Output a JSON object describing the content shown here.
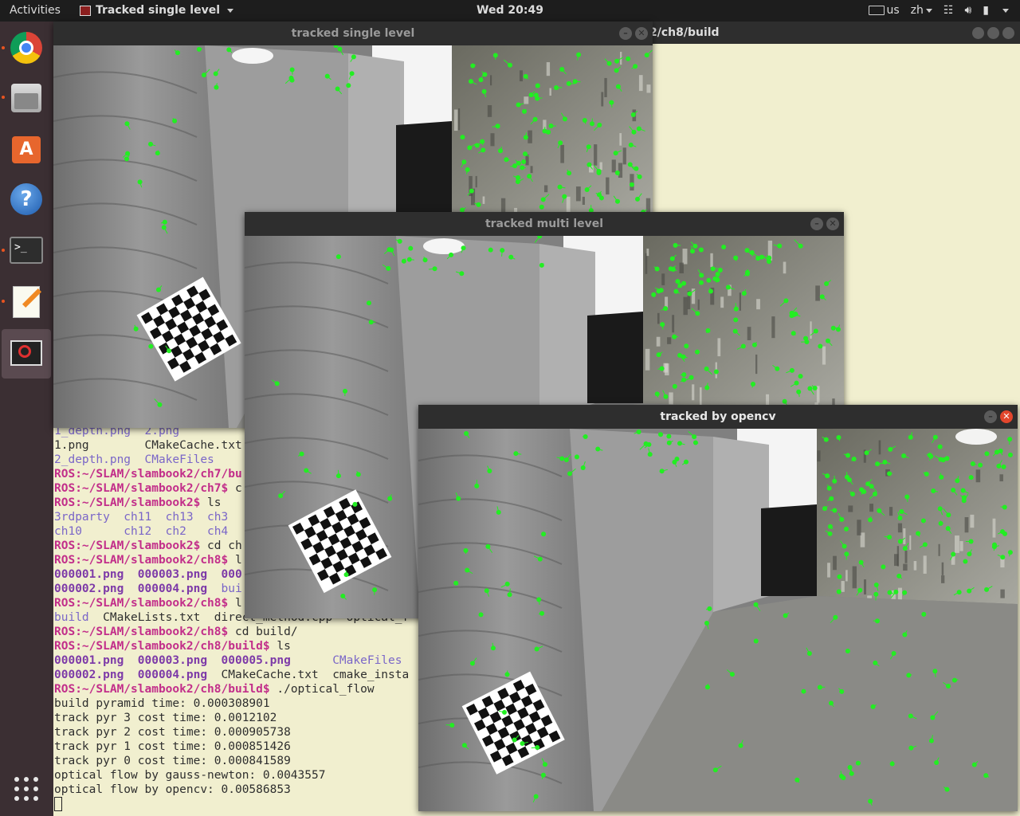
{
  "topbar": {
    "activities": "Activities",
    "app_name": "Tracked single level",
    "clock": "Wed 20:49",
    "keyboard_layout": "us",
    "input_method": "zh"
  },
  "dock": {
    "items": [
      "chrome-icon",
      "files-icon",
      "software-store-icon",
      "help-icon",
      "terminal-icon",
      "text-editor-icon",
      "opencv-window-icon"
    ],
    "accent": "#e95420"
  },
  "terminal": {
    "title_fragment": "2/ch8/build",
    "lines": [
      [
        {
          "c": "blue",
          "t": "1_depth.png  2.png"
        }
      ],
      [
        {
          "c": "cmd",
          "t": "1.png        CMakeCache.txt"
        }
      ],
      [
        {
          "c": "blue",
          "t": "2_depth.png  CMakeFiles"
        }
      ],
      [
        {
          "c": "pr",
          "t": "ROS:~/SLAM/slambook2/ch7/bu"
        }
      ],
      [
        {
          "c": "pr",
          "t": "ROS:~/SLAM/slambook2/ch7$"
        },
        {
          "c": "cmd",
          "t": " c"
        }
      ],
      [
        {
          "c": "pr",
          "t": "ROS:~/SLAM/slambook2$"
        },
        {
          "c": "cmd",
          "t": " ls"
        }
      ],
      [
        {
          "c": "blue",
          "t": "3rdparty  ch11  ch13  ch3"
        }
      ],
      [
        {
          "c": "blue",
          "t": "ch10      ch12  ch2   ch4"
        }
      ],
      [
        {
          "c": "pr",
          "t": "ROS:~/SLAM/slambook2$"
        },
        {
          "c": "cmd",
          "t": " cd ch"
        }
      ],
      [
        {
          "c": "pr",
          "t": "ROS:~/SLAM/slambook2/ch8$"
        },
        {
          "c": "cmd",
          "t": " l"
        }
      ],
      [
        {
          "c": "bold-blue",
          "t": "000001.png  000003.png  000"
        }
      ],
      [
        {
          "c": "bold-blue",
          "t": "000002.png  000004.png"
        },
        {
          "c": "blue",
          "t": "  bui"
        }
      ],
      [
        {
          "c": "pr",
          "t": "ROS:~/SLAM/slambook2/ch8$"
        },
        {
          "c": "cmd",
          "t": " l"
        }
      ],
      [
        {
          "c": "blue",
          "t": "build"
        },
        {
          "c": "cmd",
          "t": "  CMakeLists.txt  direct_method.cpp  optical_f"
        }
      ],
      [
        {
          "c": "pr",
          "t": "ROS:~/SLAM/slambook2/ch8$"
        },
        {
          "c": "cmd",
          "t": " cd build/"
        }
      ],
      [
        {
          "c": "pr",
          "t": "ROS:~/SLAM/slambook2/ch8/build$"
        },
        {
          "c": "cmd",
          "t": " ls"
        }
      ],
      [
        {
          "c": "bold-blue",
          "t": "000001.png  000003.png  000005.png"
        },
        {
          "c": "blue",
          "t": "      CMakeFiles"
        }
      ],
      [
        {
          "c": "bold-blue",
          "t": "000002.png  000004.png"
        },
        {
          "c": "cmd",
          "t": "  CMakeCache.txt  cmake_insta"
        }
      ],
      [
        {
          "c": "pr",
          "t": "ROS:~/SLAM/slambook2/ch8/build$"
        },
        {
          "c": "cmd",
          "t": " ./optical_flow"
        }
      ],
      [
        {
          "c": "cmd",
          "t": "build pyramid time: 0.000308901"
        }
      ],
      [
        {
          "c": "cmd",
          "t": "track pyr 3 cost time: 0.0012102"
        }
      ],
      [
        {
          "c": "cmd",
          "t": "track pyr 2 cost time: 0.000905738"
        }
      ],
      [
        {
          "c": "cmd",
          "t": "track pyr 1 cost time: 0.000851426"
        }
      ],
      [
        {
          "c": "cmd",
          "t": "track pyr 0 cost time: 0.000841589"
        }
      ],
      [
        {
          "c": "cmd",
          "t": "optical flow by gauss-newton: 0.0043557"
        }
      ],
      [
        {
          "c": "cmd",
          "t": "optical flow by opencv: 0.00586853"
        }
      ]
    ]
  },
  "windows": {
    "single": {
      "title": "tracked single level"
    },
    "multi": {
      "title": "tracked multi level"
    },
    "opencv": {
      "title": "tracked by opencv"
    }
  },
  "colors": {
    "feature_point": "#22ee22",
    "close_active": "#e2462c"
  }
}
